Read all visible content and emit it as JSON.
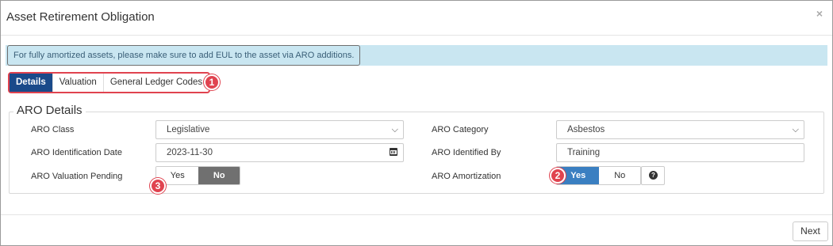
{
  "modal": {
    "title": "Asset Retirement Obligation",
    "close_glyph": "×"
  },
  "banner": {
    "text": "For fully amortized assets, please make sure to add EUL to the asset via ARO additions."
  },
  "tabs": [
    {
      "label": "Details",
      "active": true
    },
    {
      "label": "Valuation",
      "active": false
    },
    {
      "label": "General Ledger Codes",
      "active": false
    }
  ],
  "callouts": [
    "1",
    "2",
    "3"
  ],
  "section": {
    "legend": "ARO Details"
  },
  "fields": {
    "aro_class": {
      "label": "ARO Class",
      "value": "Legislative"
    },
    "aro_identification_date": {
      "label": "ARO Identification Date",
      "value": "2023-11-30"
    },
    "aro_valuation_pending": {
      "label": "ARO Valuation Pending",
      "yes": "Yes",
      "no": "No",
      "selected": "No"
    },
    "aro_category": {
      "label": "ARO Category",
      "value": "Asbestos"
    },
    "aro_identified_by": {
      "label": "ARO Identified By",
      "value": "Training"
    },
    "aro_amortization": {
      "label": "ARO Amortization",
      "yes": "Yes",
      "no": "No",
      "selected": "Yes",
      "help_glyph": "?"
    }
  },
  "icons": {
    "chevron": "chevron-down-icon",
    "calendar": "calendar-icon",
    "help": "question-circle-icon",
    "close": "close-icon"
  },
  "colors": {
    "tab_active": "#1a4a8a",
    "toggle_blue": "#3a7fc1",
    "toggle_grey": "#707070",
    "callout_red": "#e0434f",
    "banner_bg": "#c9e6f1"
  },
  "footer": {
    "next_label": "Next"
  }
}
